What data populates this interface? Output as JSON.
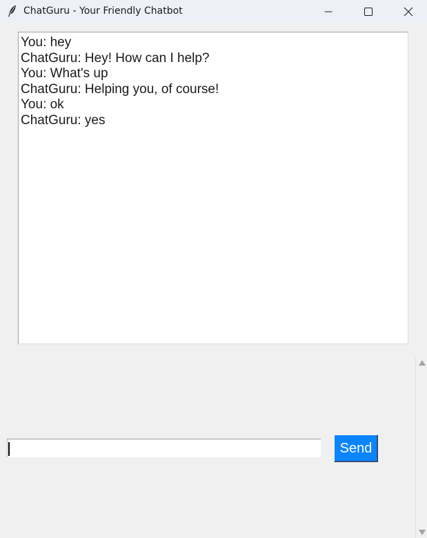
{
  "window": {
    "title": "ChatGuru - Your Friendly Chatbot",
    "app_icon": "feather-icon",
    "controls": {
      "minimize_icon": "minimize-icon",
      "maximize_icon": "maximize-icon",
      "close_icon": "close-icon"
    }
  },
  "chat": {
    "lines": [
      "You: hey",
      "ChatGuru: Hey! How can I help?",
      "You: What's up",
      "ChatGuru: Helping you, of course!",
      "You: ok",
      "ChatGuru: yes"
    ]
  },
  "input": {
    "value": "",
    "placeholder": ""
  },
  "send_button": {
    "label": "Send",
    "color": "#0a84ff"
  },
  "colors": {
    "background": "#f0f0f0",
    "titlebar": "#eef0f8",
    "chat_background": "#ffffff"
  }
}
